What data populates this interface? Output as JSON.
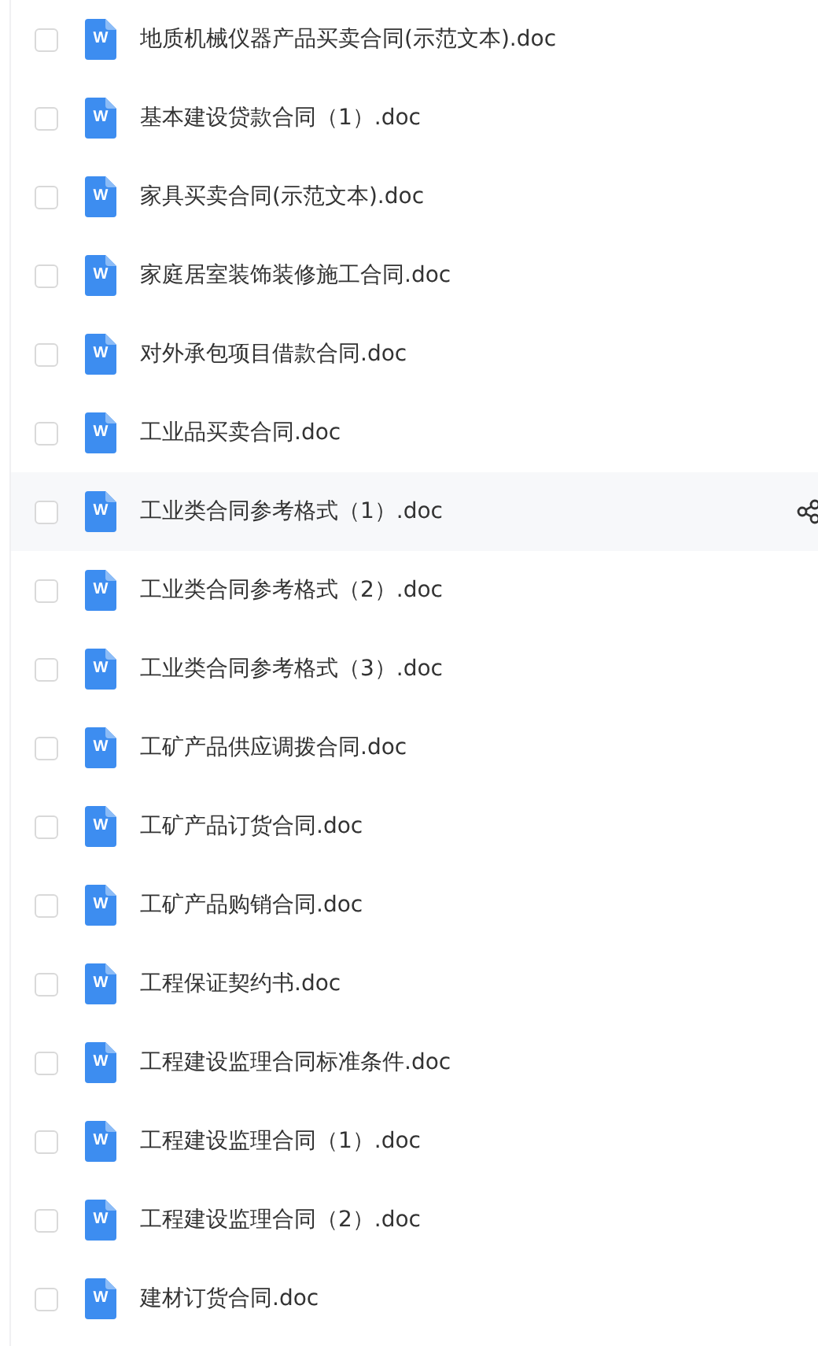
{
  "files": [
    {
      "name": "地质机械仪器产品买卖合同(示范文本).doc",
      "badge": "W",
      "checked": false,
      "hovered": false
    },
    {
      "name": "基本建设贷款合同（1）.doc",
      "badge": "W",
      "checked": false,
      "hovered": false
    },
    {
      "name": "家具买卖合同(示范文本).doc",
      "badge": "W",
      "checked": false,
      "hovered": false
    },
    {
      "name": "家庭居室装饰装修施工合同.doc",
      "badge": "W",
      "checked": false,
      "hovered": false
    },
    {
      "name": "对外承包项目借款合同.doc",
      "badge": "W",
      "checked": false,
      "hovered": false
    },
    {
      "name": "工业品买卖合同.doc",
      "badge": "W",
      "checked": false,
      "hovered": false
    },
    {
      "name": "工业类合同参考格式（1）.doc",
      "badge": "W",
      "checked": false,
      "hovered": true
    },
    {
      "name": "工业类合同参考格式（2）.doc",
      "badge": "W",
      "checked": false,
      "hovered": false
    },
    {
      "name": "工业类合同参考格式（3）.doc",
      "badge": "W",
      "checked": false,
      "hovered": false
    },
    {
      "name": "工矿产品供应调拨合同.doc",
      "badge": "W",
      "checked": false,
      "hovered": false
    },
    {
      "name": "工矿产品订货合同.doc",
      "badge": "W",
      "checked": false,
      "hovered": false
    },
    {
      "name": "工矿产品购销合同.doc",
      "badge": "W",
      "checked": false,
      "hovered": false
    },
    {
      "name": "工程保证契约书.doc",
      "badge": "W",
      "checked": false,
      "hovered": false
    },
    {
      "name": "工程建设监理合同标准条件.doc",
      "badge": "W",
      "checked": false,
      "hovered": false
    },
    {
      "name": "工程建设监理合同（1）.doc",
      "badge": "W",
      "checked": false,
      "hovered": false
    },
    {
      "name": "工程建设监理合同（2）.doc",
      "badge": "W",
      "checked": false,
      "hovered": false
    },
    {
      "name": "建材订货合同.doc",
      "badge": "W",
      "checked": false,
      "hovered": false
    }
  ]
}
